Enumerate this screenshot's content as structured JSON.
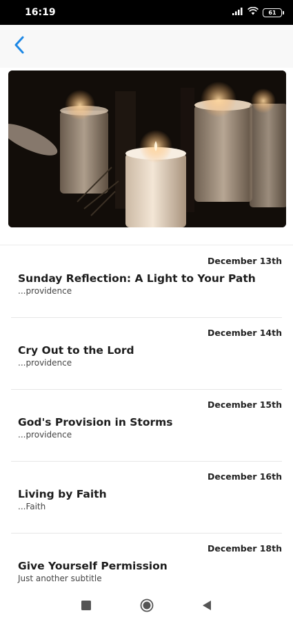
{
  "status_bar": {
    "time": "16:19",
    "battery": "61",
    "icons": [
      "signal-icon",
      "wifi-icon",
      "battery-icon"
    ]
  },
  "header": {
    "back_icon": "chevron-left-icon",
    "accent_color": "#1e88e5"
  },
  "hero": {
    "image": "candles-photo"
  },
  "items": [
    {
      "date": "December 13th",
      "title": "Sunday Reflection: A Light to Your Path",
      "subtitle": "...providence"
    },
    {
      "date": "December 14th",
      "title": "Cry Out to the Lord",
      "subtitle": "...providence"
    },
    {
      "date": "December 15th",
      "title": "God's Provision in Storms",
      "subtitle": "...providence"
    },
    {
      "date": "December 16th",
      "title": "Living by Faith",
      "subtitle": "...Faith"
    },
    {
      "date": "December 18th",
      "title": "Give Yourself Permission",
      "subtitle": "Just another subtitle"
    }
  ],
  "system_nav": {
    "icons": [
      "recents-square-icon",
      "home-circle-icon",
      "back-triangle-icon"
    ]
  }
}
